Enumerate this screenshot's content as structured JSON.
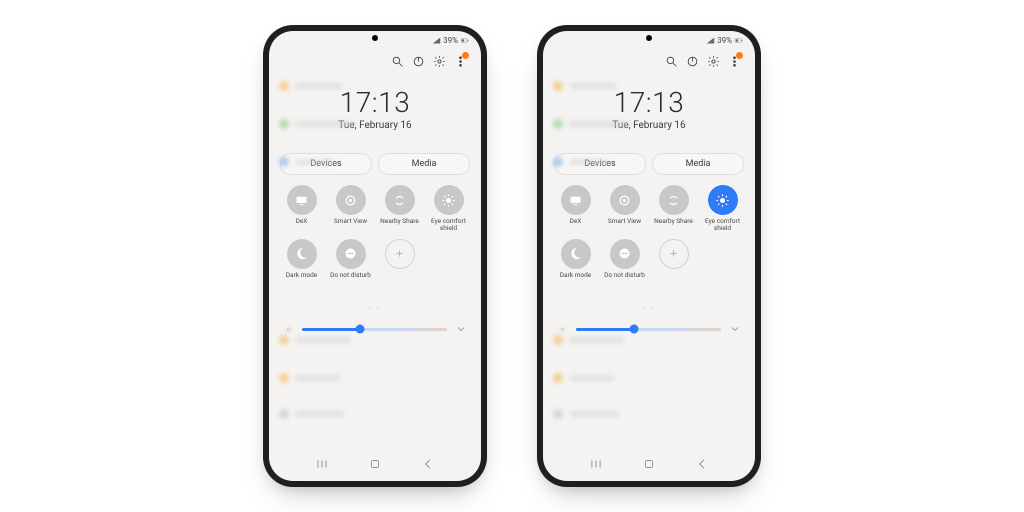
{
  "status": {
    "battery_text": "39%"
  },
  "clock": {
    "time": "17:13",
    "date": "Tue, February 16"
  },
  "chips": {
    "devices": "Devices",
    "media": "Media"
  },
  "tiles": {
    "dex": {
      "label": "DeX"
    },
    "smartview": {
      "label": "Smart View"
    },
    "nearby": {
      "label": "Nearby Share"
    },
    "eyecomfort": {
      "label": "Eye comfort shield"
    },
    "darkmode": {
      "label": "Dark mode"
    },
    "dnd": {
      "label": "Do not disturb"
    }
  },
  "pager": {
    "dots": ". ."
  },
  "slider": {
    "percent": 40
  },
  "colors": {
    "accent": "#2d7bf6",
    "badge": "#ff7a1a"
  }
}
